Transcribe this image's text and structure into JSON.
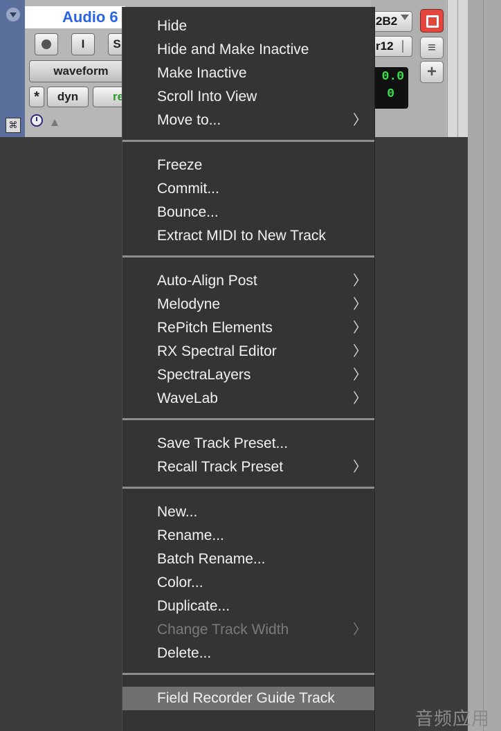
{
  "track": {
    "name": "Audio 6",
    "input_label": "I",
    "solo_label": "S",
    "view_label": "waveform",
    "asterisk_label": "*",
    "dyn_label": "dyn",
    "rel_label": "re",
    "io_label": "2B2",
    "output_label": "r12",
    "volume_readout": "0.0",
    "pan_readout": "0",
    "add_label": "+"
  },
  "menu": {
    "groups": [
      {
        "items": [
          {
            "label": "Hide",
            "submenu": false,
            "disabled": false
          },
          {
            "label": "Hide and Make Inactive",
            "submenu": false,
            "disabled": false
          },
          {
            "label": "Make Inactive",
            "submenu": false,
            "disabled": false
          },
          {
            "label": "Scroll Into View",
            "submenu": false,
            "disabled": false
          },
          {
            "label": "Move to...",
            "submenu": true,
            "disabled": false
          }
        ]
      },
      {
        "items": [
          {
            "label": "Freeze",
            "submenu": false,
            "disabled": false
          },
          {
            "label": "Commit...",
            "submenu": false,
            "disabled": false
          },
          {
            "label": "Bounce...",
            "submenu": false,
            "disabled": false
          },
          {
            "label": "Extract MIDI to New Track",
            "submenu": false,
            "disabled": false
          }
        ]
      },
      {
        "items": [
          {
            "label": "Auto-Align Post",
            "submenu": true,
            "disabled": false
          },
          {
            "label": "Melodyne",
            "submenu": true,
            "disabled": false
          },
          {
            "label": "RePitch Elements",
            "submenu": true,
            "disabled": false
          },
          {
            "label": "RX Spectral Editor",
            "submenu": true,
            "disabled": false
          },
          {
            "label": "SpectraLayers",
            "submenu": true,
            "disabled": false
          },
          {
            "label": "WaveLab",
            "submenu": true,
            "disabled": false
          }
        ]
      },
      {
        "items": [
          {
            "label": "Save Track Preset...",
            "submenu": false,
            "disabled": false
          },
          {
            "label": "Recall Track Preset",
            "submenu": true,
            "disabled": false
          }
        ]
      },
      {
        "items": [
          {
            "label": "New...",
            "submenu": false,
            "disabled": false
          },
          {
            "label": "Rename...",
            "submenu": false,
            "disabled": false
          },
          {
            "label": "Batch Rename...",
            "submenu": false,
            "disabled": false
          },
          {
            "label": "Color...",
            "submenu": false,
            "disabled": false
          },
          {
            "label": "Duplicate...",
            "submenu": false,
            "disabled": false
          },
          {
            "label": "Change Track Width",
            "submenu": true,
            "disabled": true
          },
          {
            "label": "Delete...",
            "submenu": false,
            "disabled": false
          }
        ]
      },
      {
        "items": [
          {
            "label": "Field Recorder Guide Track",
            "submenu": false,
            "disabled": false,
            "highlighted": true
          }
        ]
      }
    ],
    "submenu_glyph": "〉"
  },
  "watermark": "音频应用"
}
